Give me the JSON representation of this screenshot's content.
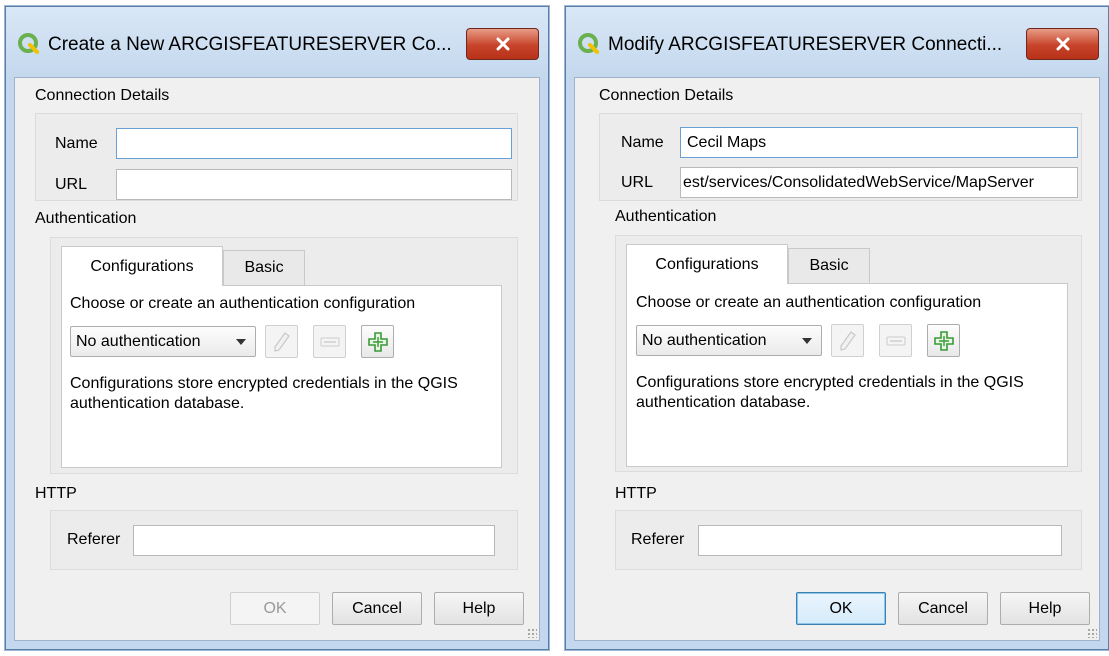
{
  "dialogs": [
    {
      "title": "Create a New ARCGISFEATURESERVER Co...",
      "connection_details_label": "Connection Details",
      "name_label": "Name",
      "name_value": "",
      "url_label": "URL",
      "url_value": "",
      "authentication_label": "Authentication",
      "tabs": [
        "Configurations",
        "Basic"
      ],
      "choose_text": "Choose or create an authentication configuration",
      "auth_combo_value": "No authentication",
      "description": "Configurations store encrypted credentials in the QGIS authentication database.",
      "http_label": "HTTP",
      "referer_label": "Referer",
      "referer_value": "",
      "buttons": {
        "ok": "OK",
        "cancel": "Cancel",
        "help": "Help"
      }
    },
    {
      "title": "Modify ARCGISFEATURESERVER Connecti...",
      "connection_details_label": "Connection Details",
      "name_label": "Name",
      "name_value": "Cecil Maps",
      "url_label": "URL",
      "url_value": "est/services/ConsolidatedWebService/MapServer",
      "authentication_label": "Authentication",
      "tabs": [
        "Configurations",
        "Basic"
      ],
      "choose_text": "Choose or create an authentication configuration",
      "auth_combo_value": "No authentication",
      "description": "Configurations store encrypted credentials in the QGIS authentication database.",
      "http_label": "HTTP",
      "referer_label": "Referer",
      "referer_value": "",
      "buttons": {
        "ok": "OK",
        "cancel": "Cancel",
        "help": "Help"
      }
    }
  ],
  "icons": {
    "app": "qgis-logo-icon",
    "close": "close-icon",
    "edit": "pencil-icon",
    "remove": "minus-icon",
    "add": "plus-icon",
    "dropdown": "chevron-down-icon"
  },
  "colors": {
    "title_bar": "#c4d8ee",
    "close_button": "#c7432a",
    "focus_border": "#6aa0d8",
    "add_icon_green": "#3a9a3a"
  }
}
